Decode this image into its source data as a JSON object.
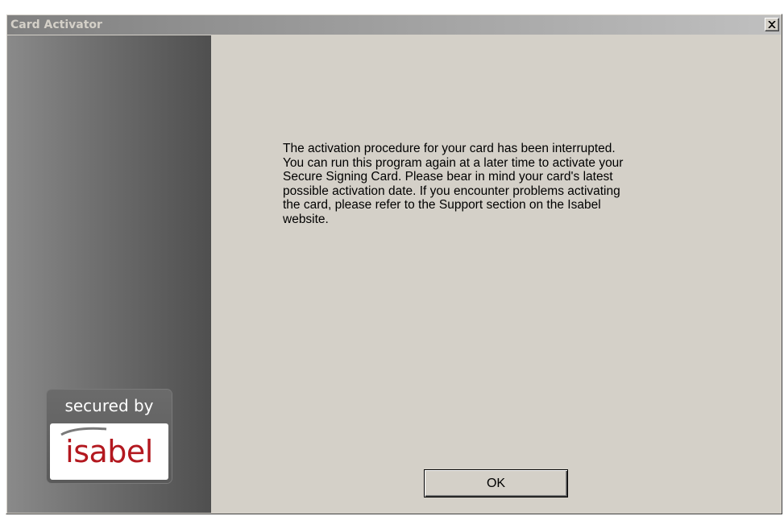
{
  "window": {
    "title": "Card Activator"
  },
  "titlebar": {
    "close_icon": "close-icon"
  },
  "sidebar": {
    "logo": {
      "tagline": "secured by",
      "brand": "isabel",
      "brand_color": "#b3181f"
    }
  },
  "message": {
    "lines": [
      "The activation procedure for your card has been interrupted.",
      "You can run this program again at a later time to activate your",
      "Secure Signing Card. Please bear in mind your card's latest",
      "possible activation date. If you encounter problems activating",
      "the card, please refer to the Support section on the Isabel",
      "website."
    ]
  },
  "buttons": {
    "ok_label": "OK"
  }
}
